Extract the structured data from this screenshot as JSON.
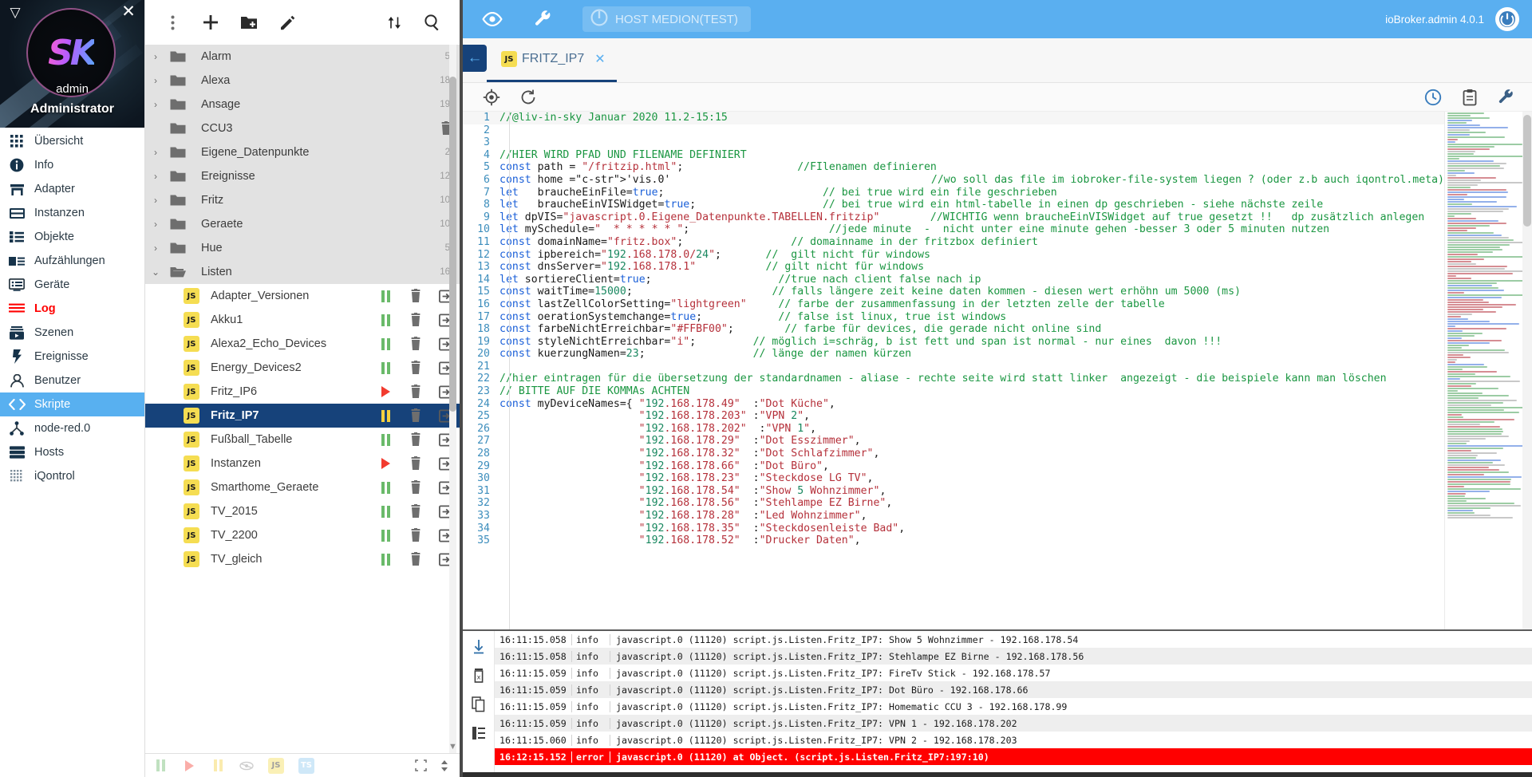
{
  "nav": {
    "user": "admin",
    "role": "Administrator",
    "logo_text": "SK",
    "collapse_icon": "triangle-down-icon",
    "close_icon": "close-icon",
    "items": [
      {
        "label": "Übersicht",
        "icon": "grid-icon",
        "state": "normal"
      },
      {
        "label": "Info",
        "icon": "info-icon",
        "state": "normal"
      },
      {
        "label": "Adapter",
        "icon": "store-icon",
        "state": "normal"
      },
      {
        "label": "Instanzen",
        "icon": "instances-icon",
        "state": "normal"
      },
      {
        "label": "Objekte",
        "icon": "list-icon",
        "state": "normal"
      },
      {
        "label": "Aufzählungen",
        "icon": "enum-icon",
        "state": "normal"
      },
      {
        "label": "Geräte",
        "icon": "device-icon",
        "state": "normal"
      },
      {
        "label": "Log",
        "icon": "log-icon",
        "state": "alert"
      },
      {
        "label": "Szenen",
        "icon": "scenes-icon",
        "state": "normal"
      },
      {
        "label": "Ereignisse",
        "icon": "bolt-icon",
        "state": "normal"
      },
      {
        "label": "Benutzer",
        "icon": "user-icon",
        "state": "normal"
      },
      {
        "label": "Skripte",
        "icon": "code-icon",
        "state": "active"
      },
      {
        "label": "node-red.0",
        "icon": "nodered-icon",
        "state": "normal"
      },
      {
        "label": "Hosts",
        "icon": "server-icon",
        "state": "normal"
      },
      {
        "label": "iQontrol",
        "icon": "iqontrol-icon",
        "state": "normal"
      }
    ]
  },
  "topbar": {
    "eye_icon": "eye-icon",
    "wrench_icon": "wrench-icon",
    "host_label": "HOST MEDION(TEST)",
    "host_power_icon": "power-icon",
    "version": "ioBroker.admin 4.0.1",
    "brand_icon": "iobroker-logo-icon"
  },
  "tree_toolbar": {
    "menu_icon": "more-vert-icon",
    "add_icon": "plus-icon",
    "add_folder_icon": "new-folder-icon",
    "edit_icon": "pencil-icon",
    "expand_icon": "expand-collapse-icon",
    "search_icon": "search-icon"
  },
  "tree": {
    "folders": [
      {
        "label": "Alarm",
        "count": "5",
        "expanded": false,
        "has_children": true
      },
      {
        "label": "Alexa",
        "count": "18",
        "expanded": false,
        "has_children": true
      },
      {
        "label": "Ansage",
        "count": "19",
        "expanded": false,
        "has_children": true
      },
      {
        "label": "CCU3",
        "count": "",
        "expanded": false,
        "has_children": false,
        "trash": true
      },
      {
        "label": "Eigene_Datenpunkte",
        "count": "2",
        "expanded": false,
        "has_children": true
      },
      {
        "label": "Ereignisse",
        "count": "12",
        "expanded": false,
        "has_children": true
      },
      {
        "label": "Fritz",
        "count": "10",
        "expanded": false,
        "has_children": true
      },
      {
        "label": "Geraete",
        "count": "10",
        "expanded": false,
        "has_children": true
      },
      {
        "label": "Hue",
        "count": "5",
        "expanded": false,
        "has_children": true
      },
      {
        "label": "Listen",
        "count": "16",
        "expanded": true,
        "has_children": true
      }
    ],
    "scripts": [
      {
        "label": "Adapter_Versionen",
        "status": "paused",
        "selected": false
      },
      {
        "label": "Akku1",
        "status": "paused",
        "selected": false
      },
      {
        "label": "Alexa2_Echo_Devices",
        "status": "paused",
        "selected": false
      },
      {
        "label": "Energy_Devices2",
        "status": "paused",
        "selected": false
      },
      {
        "label": "Fritz_IP6",
        "status": "running",
        "selected": false
      },
      {
        "label": "Fritz_IP7",
        "status": "paused",
        "selected": true
      },
      {
        "label": "Fußball_Tabelle",
        "status": "paused",
        "selected": false
      },
      {
        "label": "Instanzen",
        "status": "running",
        "selected": false
      },
      {
        "label": "Smarthome_Geraete",
        "status": "paused",
        "selected": false
      },
      {
        "label": "TV_2015",
        "status": "paused",
        "selected": false
      },
      {
        "label": "TV_2200",
        "status": "paused",
        "selected": false
      },
      {
        "label": "TV_gleich",
        "status": "paused",
        "selected": false
      }
    ],
    "script_badge": "JS",
    "row_icons": {
      "pause_icon": "pause-icon",
      "play_icon": "play-icon",
      "delete_icon": "trash-icon",
      "export_icon": "export-icon"
    }
  },
  "tree_bottom": {
    "pause_icon": "pause-icon",
    "play_icon": "play-icon",
    "pause_yellow_icon": "pause-yellow-icon",
    "hidden_icon": "hidden-filter-icon",
    "js_badge": "JS",
    "ts_badge": "TS",
    "resize_icon": "resize-icon",
    "updown_icon": "up-down-icon"
  },
  "tab": {
    "back_icon": "arrow-left-icon",
    "badge": "JS",
    "title": "FRITZ_IP7",
    "close_icon": "close-icon"
  },
  "editor_toolbar": {
    "locate_icon": "crosshair-icon",
    "reload_icon": "reload-icon",
    "history_icon": "clock-icon",
    "clipboard_icon": "clipboard-icon",
    "settings_icon": "wrench-icon"
  },
  "code": [
    {
      "n": "1",
      "t": "//@liv-in-sky Januar 2020 11.2-15:15",
      "k": "com"
    },
    {
      "n": "2",
      "t": "",
      "k": "plain"
    },
    {
      "n": "3",
      "t": "",
      "k": "plain"
    },
    {
      "n": "4",
      "t": "//HIER WIRD PFAD UND FILENAME DEFINIERT",
      "k": "com"
    },
    {
      "n": "5",
      "t": "const path = \"/fritzip.html\";                  //FIlenamen definieren",
      "k": "mix"
    },
    {
      "n": "6",
      "t": "const home ='vis.0'                                //wo soll das file im iobroker-file-system liegen ? (oder z.b auch iqontrol.meta)",
      "k": "mix"
    },
    {
      "n": "7",
      "t": "let   braucheEinFile=true;                         // bei true wird ein file geschrieben",
      "k": "mix"
    },
    {
      "n": "8",
      "t": "let   braucheEinVISWidget=true;                    // bei true wird ein html-tabelle in einen dp geschrieben - siehe nächste zeile",
      "k": "mix"
    },
    {
      "n": "9",
      "t": "let dpVIS=\"javascript.0.Eigene_Datenpunkte.TABELLEN.fritzip\"        //WICHTIG wenn braucheEinVISWidget auf true gesetzt !!   dp zusätzlich anlegen",
      "k": "mix"
    },
    {
      "n": "10",
      "t": "let mySchedule=\"  * * * * * \";                      //jede minute  -  nicht unter eine minute gehen -besser 3 oder 5 minuten nutzen",
      "k": "mix"
    },
    {
      "n": "11",
      "t": "const domainName=\"fritz.box\";                 // domainname in der fritzbox definiert",
      "k": "mix"
    },
    {
      "n": "12",
      "t": "const ipbereich=\"192.168.178.0/24\";       //  gilt nicht für windows",
      "k": "mix"
    },
    {
      "n": "13",
      "t": "const dnsServer=\"192.168.178.1\"           // gilt nicht für windows",
      "k": "mix"
    },
    {
      "n": "14",
      "t": "let sortiereClient=true;                    //true nach client false nach ip",
      "k": "mix"
    },
    {
      "n": "15",
      "t": "const waitTime=15000;                      // falls längere zeit keine daten kommen - diesen wert erhöhn um 5000 (ms)",
      "k": "mix"
    },
    {
      "n": "16",
      "t": "const lastZellColorSetting=\"lightgreen\"     // farbe der zusammenfassung in der letzten zelle der tabelle",
      "k": "mix"
    },
    {
      "n": "17",
      "t": "const oerationSystemchange=true;            // false ist linux, true ist windows",
      "k": "mix"
    },
    {
      "n": "18",
      "t": "const farbeNichtErreichbar=\"#FFBF00\";        // farbe für devices, die gerade nicht online sind",
      "k": "mix"
    },
    {
      "n": "19",
      "t": "const styleNichtErreichbar=\"i\";         // möglich i=schräg, b ist fett und span ist normal - nur eines  davon !!!",
      "k": "mix"
    },
    {
      "n": "20",
      "t": "const kuerzungNamen=23;                 // länge der namen kürzen",
      "k": "mix"
    },
    {
      "n": "21",
      "t": "",
      "k": "plain"
    },
    {
      "n": "22",
      "t": "//hier eintragen für die übersetzung der standardnamen - aliase - rechte seite wird statt linker  angezeigt - die beispiele kann man löschen",
      "k": "com"
    },
    {
      "n": "23",
      "t": "// BITTE AUF DIE KOMMAs ACHTEN",
      "k": "com"
    },
    {
      "n": "24",
      "t": "const myDeviceNames={ \"192.168.178.49\"  :\"Dot Küche\",",
      "k": "mix"
    },
    {
      "n": "25",
      "t": "                      \"192.168.178.203\" :\"VPN 2\",",
      "k": "mix"
    },
    {
      "n": "26",
      "t": "                      \"192.168.178.202\"  :\"VPN 1\",",
      "k": "mix"
    },
    {
      "n": "27",
      "t": "                      \"192.168.178.29\"  :\"Dot Esszimmer\",",
      "k": "mix"
    },
    {
      "n": "28",
      "t": "                      \"192.168.178.32\"  :\"Dot Schlafzimmer\",",
      "k": "mix"
    },
    {
      "n": "29",
      "t": "                      \"192.168.178.66\"  :\"Dot Büro\",",
      "k": "mix"
    },
    {
      "n": "30",
      "t": "                      \"192.168.178.23\"  :\"Steckdose LG TV\",",
      "k": "mix"
    },
    {
      "n": "31",
      "t": "                      \"192.168.178.54\"  :\"Show 5 Wohnzimmer\",",
      "k": "mix"
    },
    {
      "n": "32",
      "t": "                      \"192.168.178.56\"  :\"Stehlampe EZ Birne\",",
      "k": "mix"
    },
    {
      "n": "33",
      "t": "                      \"192.168.178.28\"  :\"Led Wohnzimmer\",",
      "k": "mix"
    },
    {
      "n": "34",
      "t": "                      \"192.168.178.35\"  :\"Steckdosenleiste Bad\",",
      "k": "mix"
    },
    {
      "n": "35",
      "t": "                      \"192.168.178.52\"  :\"Drucker Daten\",",
      "k": "mix"
    }
  ],
  "log": {
    "tool_icons": [
      "scroll-bottom-icon",
      "clear-log-icon",
      "copy-icon",
      "layout-icon"
    ],
    "rows": [
      {
        "ts": "16:11:15.058",
        "sev": "info",
        "msg": "javascript.0 (11120) script.js.Listen.Fritz_IP7: Show 5 Wohnzimmer - 192.168.178.54",
        "level": "info"
      },
      {
        "ts": "16:11:15.058",
        "sev": "info",
        "msg": "javascript.0 (11120) script.js.Listen.Fritz_IP7: Stehlampe EZ Birne - 192.168.178.56",
        "level": "info"
      },
      {
        "ts": "16:11:15.059",
        "sev": "info",
        "msg": "javascript.0 (11120) script.js.Listen.Fritz_IP7: FireTv Stick - 192.168.178.57",
        "level": "info"
      },
      {
        "ts": "16:11:15.059",
        "sev": "info",
        "msg": "javascript.0 (11120) script.js.Listen.Fritz_IP7: Dot Büro - 192.168.178.66",
        "level": "info"
      },
      {
        "ts": "16:11:15.059",
        "sev": "info",
        "msg": "javascript.0 (11120) script.js.Listen.Fritz_IP7: Homematic CCU 3 - 192.168.178.99",
        "level": "info"
      },
      {
        "ts": "16:11:15.059",
        "sev": "info",
        "msg": "javascript.0 (11120) script.js.Listen.Fritz_IP7: VPN 1 - 192.168.178.202",
        "level": "info"
      },
      {
        "ts": "16:11:15.060",
        "sev": "info",
        "msg": "javascript.0 (11120) script.js.Listen.Fritz_IP7: VPN 2 - 192.168.178.203",
        "level": "info"
      },
      {
        "ts": "16:12:15.152",
        "sev": "error",
        "msg": "javascript.0 (11120) at Object.<anonymous> (script.js.Listen.Fritz_IP7:197:10)",
        "level": "error"
      }
    ]
  },
  "colors": {
    "accent": "#5aaff0",
    "selected_row": "#16427a",
    "error": "#ff0000",
    "js_badge": "#f5dd52",
    "folder_row": "#e2e2e2"
  }
}
